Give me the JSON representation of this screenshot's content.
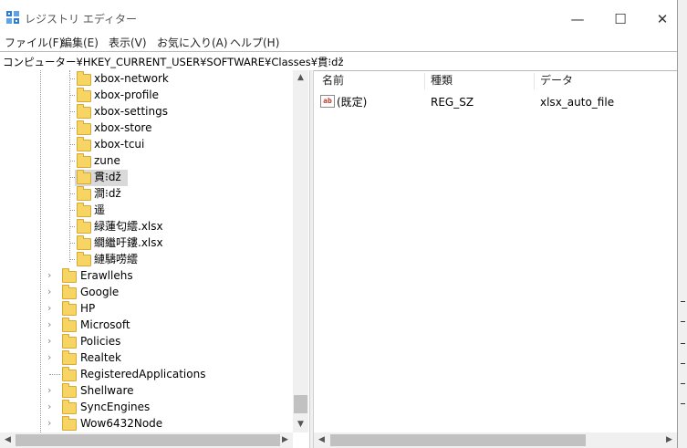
{
  "window": {
    "title": "レジストリ エディター",
    "controls": {
      "minimize": "—",
      "maximize": "☐",
      "close": "✕"
    }
  },
  "menu": {
    "items": [
      "ファイル(F)",
      "編集(E)",
      "表示(V)",
      "お気に入り(A)",
      "ヘルプ(H)"
    ]
  },
  "address": {
    "path": "コンピューター¥HKEY_CURRENT_USER¥SOFTWARE¥Classes¥貫⁝dž"
  },
  "tree": {
    "subkeys": [
      "xbox-network",
      "xbox-profile",
      "xbox-settings",
      "xbox-store",
      "xbox-tcui",
      "zune",
      "貫⁝dž",
      "澗⁝dž",
      "遥",
      "緑蓮匂繧.xlsx",
      "繝繼吁鏤.xlsx",
      "縺䮻唠繧"
    ],
    "selected": "貫⁝dž",
    "top_keys": [
      "Erawllehs",
      "Google",
      "HP",
      "Microsoft",
      "Policies",
      "Realtek",
      "RegisteredApplications",
      "Shellware",
      "SyncEngines",
      "Wow6432Node"
    ],
    "top_keys_expandable": [
      true,
      true,
      true,
      true,
      true,
      true,
      false,
      true,
      true,
      true
    ]
  },
  "list": {
    "columns": {
      "name": "名前",
      "type": "種類",
      "data": "データ"
    },
    "rows": [
      {
        "icon": "string-value-icon",
        "icon_text": "ab",
        "name": "(既定)",
        "type": "REG_SZ",
        "data": "xlsx_auto_file"
      }
    ]
  },
  "icons": {
    "app": "registry-editor-icon",
    "folder": "folder-icon",
    "chevron": "chevron-right-icon",
    "scroll_up": "▲",
    "scroll_down": "▼",
    "scroll_left": "◀",
    "scroll_right": "▶"
  }
}
